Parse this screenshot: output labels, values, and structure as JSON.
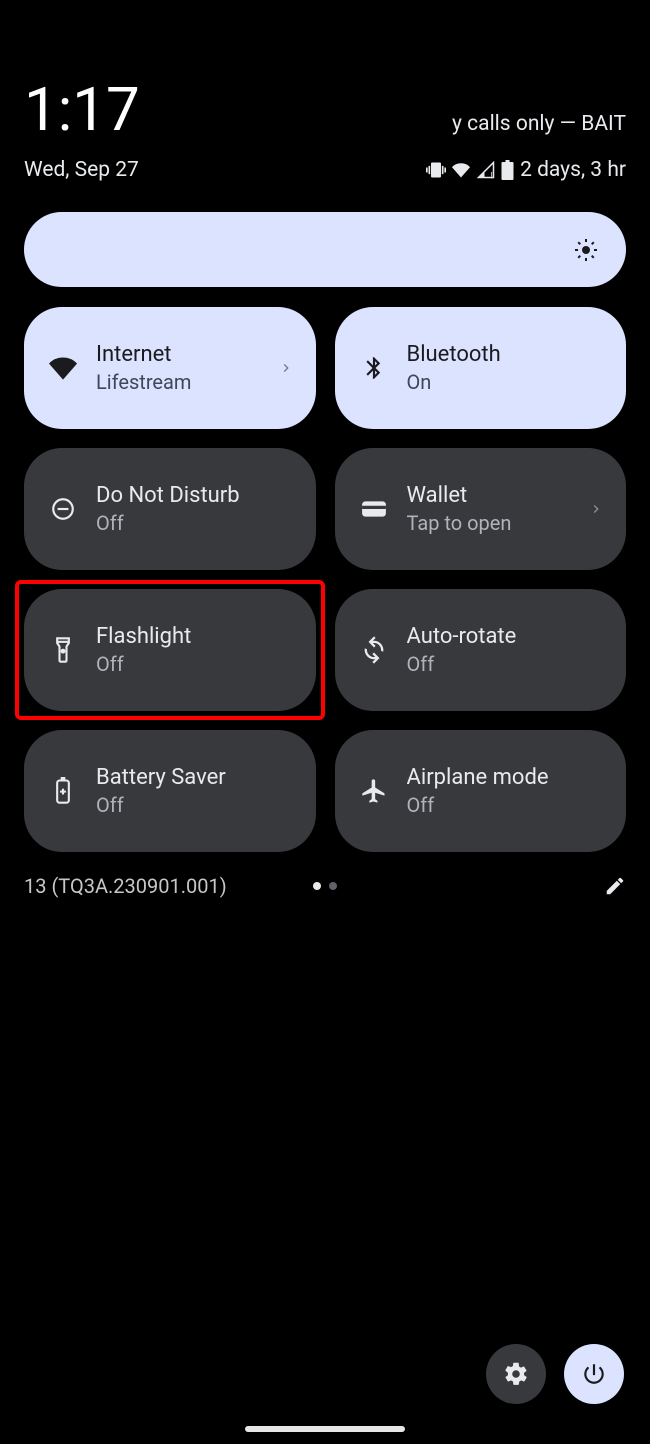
{
  "header": {
    "time": "1:17",
    "carrier": "y calls only — BAIT",
    "date": "Wed, Sep 27",
    "battery_text": "2 days, 3 hr"
  },
  "tiles": [
    {
      "id": "internet",
      "title": "Internet",
      "sub": "Lifestream",
      "active": true,
      "chevron": true,
      "icon": "wifi"
    },
    {
      "id": "bluetooth",
      "title": "Bluetooth",
      "sub": "On",
      "active": true,
      "chevron": false,
      "icon": "bluetooth"
    },
    {
      "id": "dnd",
      "title": "Do Not Disturb",
      "sub": "Off",
      "active": false,
      "chevron": false,
      "icon": "dnd"
    },
    {
      "id": "wallet",
      "title": "Wallet",
      "sub": "Tap to open",
      "active": false,
      "chevron": true,
      "icon": "wallet"
    },
    {
      "id": "flashlight",
      "title": "Flashlight",
      "sub": "Off",
      "active": false,
      "chevron": false,
      "icon": "flashlight",
      "highlighted": true
    },
    {
      "id": "autorotate",
      "title": "Auto-rotate",
      "sub": "Off",
      "active": false,
      "chevron": false,
      "icon": "autorotate"
    },
    {
      "id": "battery",
      "title": "Battery Saver",
      "sub": "Off",
      "active": false,
      "chevron": false,
      "icon": "battery"
    },
    {
      "id": "airplane",
      "title": "Airplane mode",
      "sub": "Off",
      "active": false,
      "chevron": false,
      "icon": "airplane"
    }
  ],
  "footer": {
    "build": "13 (TQ3A.230901.001)"
  }
}
